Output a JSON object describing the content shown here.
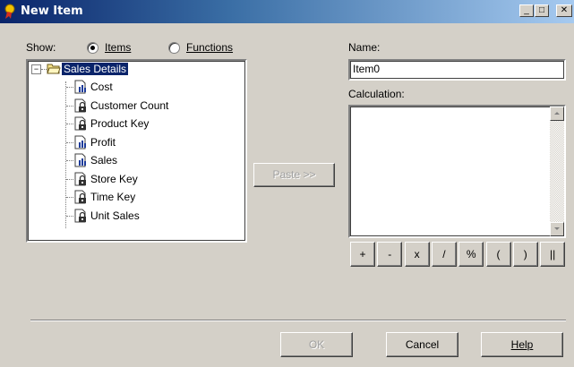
{
  "window": {
    "title": "New Item",
    "icon": "wand-ribbon-icon"
  },
  "show": {
    "label": "Show:",
    "options": [
      {
        "label": "Items",
        "selected": true
      },
      {
        "label": "Functions",
        "selected": false
      }
    ]
  },
  "tree": {
    "root": {
      "label": "Sales Details",
      "expander": "−"
    },
    "items": [
      {
        "label": "Cost",
        "icon": "measure-icon"
      },
      {
        "label": "Customer Count",
        "icon": "lock-icon"
      },
      {
        "label": "Product Key",
        "icon": "lock-icon"
      },
      {
        "label": "Profit",
        "icon": "measure-icon"
      },
      {
        "label": "Sales",
        "icon": "measure-icon"
      },
      {
        "label": "Store Key",
        "icon": "lock-icon"
      },
      {
        "label": "Time Key",
        "icon": "lock-icon"
      },
      {
        "label": "Unit Sales",
        "icon": "lock-icon"
      }
    ]
  },
  "paste_button": "Paste >>",
  "name": {
    "label": "Name:",
    "value": "Item0"
  },
  "calculation": {
    "label": "Calculation:",
    "value": ""
  },
  "operators": [
    "+",
    "-",
    "x",
    "/",
    "%",
    "(",
    ")",
    "||"
  ],
  "buttons": {
    "ok": "OK",
    "cancel": "Cancel",
    "help": "Help"
  }
}
